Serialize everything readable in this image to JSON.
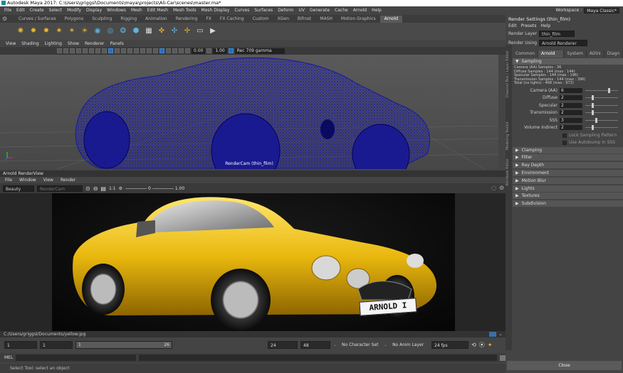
{
  "window": {
    "title": "Autodesk Maya 2017: C:\\Users\\griggsl\\Documents\\maya\\projects\\Ali-Car\\scenes\\master.ma*"
  },
  "menubar": [
    "File",
    "Edit",
    "Create",
    "Select",
    "Modify",
    "Display",
    "Windows",
    "Mesh",
    "Edit Mesh",
    "Mesh Tools",
    "Mesh Display",
    "Curves",
    "Surfaces",
    "Deform",
    "UV",
    "Generate",
    "Cache",
    "Arnold",
    "Help"
  ],
  "workspace": {
    "label": "Workspace :",
    "value": "Maya Classic*"
  },
  "shelf": {
    "tabs": [
      "Curves / Surfaces",
      "Polygons",
      "Sculpting",
      "Rigging",
      "Animation",
      "Rendering",
      "FX",
      "FX Caching",
      "Custom",
      "XGen",
      "Bifrost",
      "MASH",
      "Motion Graphics",
      "Arnold"
    ],
    "active_tab": 13,
    "icons": [
      "sun-icon",
      "sun-icon",
      "sun-icon",
      "sun-icon",
      "sun-icon",
      "sun-icon",
      "sphere-icon",
      "sphere-icon",
      "sphere-icon",
      "cube-icon",
      "grid-icon",
      "grid-icon",
      "grid-icon",
      "grid-icon",
      "render-view-icon",
      "play-icon"
    ]
  },
  "viewport": {
    "menu": [
      "View",
      "Shading",
      "Lighting",
      "Show",
      "Renderer",
      "Panels"
    ],
    "field1": "0.00",
    "field2": "1.00",
    "colorspace": "Rec 709 gamma",
    "camera_label": "RenderCam (thin_film)"
  },
  "render_view": {
    "title": "Arnold RenderView",
    "menu": [
      "File",
      "Window",
      "View",
      "Render"
    ],
    "aov": "Beauty",
    "camera_dd": "RenderCam (thin_f...",
    "ratio": "1:1",
    "value1": "0",
    "value2": "1.00",
    "plate": "ARNOLD I",
    "path": "C:/Users/griggsl/Documents/yellow.jpg"
  },
  "timeline": {
    "start": "1",
    "current": "1",
    "range_start": "1",
    "range_end": "26",
    "end": "24",
    "end2": "48",
    "character_set": "No Character Set",
    "anim_layer": "No Anim Layer",
    "fps": "24 fps"
  },
  "mel": {
    "label": "MEL",
    "help": "Select Tool: select an object"
  },
  "render_settings": {
    "title": "Render Settings (thin_film)",
    "menu": [
      "Edit",
      "Presets",
      "Help"
    ],
    "render_layer_label": "Render Layer",
    "render_layer": "thin_film",
    "render_using_label": "Render Using",
    "render_using": "Arnold Renderer",
    "tabs": [
      "Common",
      "Arnold Renderer",
      "System",
      "AOVs",
      "Diagn"
    ],
    "active_tab": 1,
    "side_tabs": [
      "Channel Box / Layer Editor",
      "Modeling Toolkit",
      "Attribute Editor"
    ],
    "sampling_header": "Sampling",
    "sampling_info": [
      "Camera (AA) Samples : 36",
      "Diffuse Samples : 144 (max : 144)",
      "Specular Samples : 144 (max : 196)",
      "Transmission Samples : 144 (max : 396)",
      "Total (no lights) : 468 (max : 972)"
    ],
    "params": [
      {
        "label": "Camera (AA)",
        "value": "6",
        "slider": 0.7
      },
      {
        "label": "Diffuse",
        "value": "2",
        "slider": 0.2
      },
      {
        "label": "Specular",
        "value": "2",
        "slider": 0.2
      },
      {
        "label": "Transmission",
        "value": "2",
        "slider": 0.2
      },
      {
        "label": "SSS",
        "value": "3",
        "slider": 0.3
      },
      {
        "label": "Volume Indirect",
        "value": "2",
        "slider": 0.2
      }
    ],
    "checks": [
      "Lock Sampling Pattern",
      "Use Autobump in SSS"
    ],
    "sections": [
      "Clamping",
      "Filter",
      "Ray Depth",
      "Environment",
      "Motion Blur",
      "Lights",
      "Textures",
      "Subdivision"
    ],
    "close_label": "Close"
  }
}
